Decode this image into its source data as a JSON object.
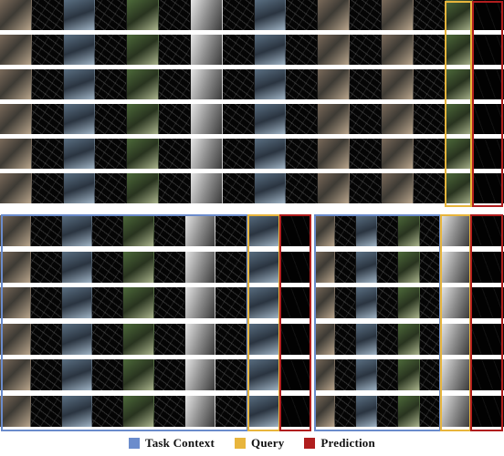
{
  "legend": {
    "items": [
      {
        "label": "Task Context",
        "color": "#6b8ccc",
        "icon": "square-swatch"
      },
      {
        "label": "Query",
        "color": "#e8b53c",
        "icon": "square-swatch"
      },
      {
        "label": "Prediction",
        "color": "#b01e1e",
        "icon": "square-swatch"
      }
    ]
  },
  "colors": {
    "task_context_frame": "#6b8ccc",
    "query_frame": "#e8b53c",
    "prediction_frame": "#b01e1e",
    "row_separator": "#ffffff"
  },
  "panels": {
    "top": {
      "rows": 6,
      "context_pairs": 7,
      "query_tiles": 1,
      "prediction_tiles": 1
    },
    "bottom_left": {
      "rows": 6,
      "context_pairs": 4,
      "query_tiles": 1,
      "prediction_tiles": 1
    },
    "bottom_right": {
      "rows": 6,
      "context_pairs": 3,
      "query_tiles": 1,
      "prediction_tiles": 1
    }
  }
}
